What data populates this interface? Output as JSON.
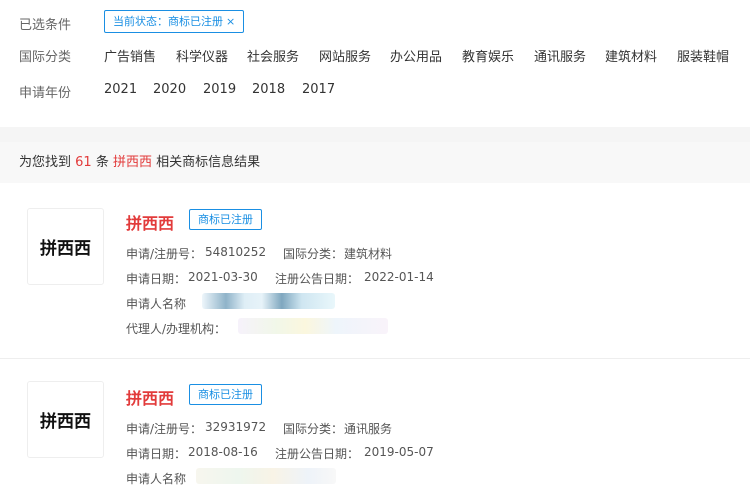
{
  "filters": {
    "selected_label": "已选条件",
    "selected_tag": "当前状态：商标已注册",
    "tag_close": "×",
    "class_label": "国际分类",
    "class_options": [
      "广告销售",
      "科学仪器",
      "社会服务",
      "网站服务",
      "办公用品",
      "教育娱乐",
      "通讯服务",
      "建筑材料",
      "服装鞋帽"
    ],
    "year_label": "申请年份",
    "year_options": [
      "2021",
      "2020",
      "2019",
      "2018",
      "2017"
    ]
  },
  "summary": {
    "prefix": "为您找到",
    "count": "61",
    "unit": "条",
    "keyword": "拼西西",
    "suffix": "相关商标信息结果"
  },
  "results": [
    {
      "logo_text": "拼西西",
      "name": "拼西西",
      "status": "商标已注册",
      "reg_no_label": "申请/注册号：",
      "reg_no": "54810252",
      "class_label": "国际分类：",
      "class_value": "建筑材料",
      "apply_date_label": "申请日期：",
      "apply_date": "2021-03-30",
      "pub_date_label": "注册公告日期：",
      "pub_date": "2022-01-14",
      "applicant_label": "申请人名称",
      "agent_label": "代理人/办理机构："
    },
    {
      "logo_text": "拼西西",
      "name": "拼西西",
      "status": "商标已注册",
      "reg_no_label": "申请/注册号：",
      "reg_no": "32931972",
      "class_label": "国际分类：",
      "class_value": "通讯服务",
      "apply_date_label": "申请日期：",
      "apply_date": "2018-08-16",
      "pub_date_label": "注册公告日期：",
      "pub_date": "2019-05-07",
      "applicant_label": "申请人名称"
    }
  ],
  "colors": {
    "accent": "#1a8fe3",
    "highlight": "#e23b3b"
  }
}
